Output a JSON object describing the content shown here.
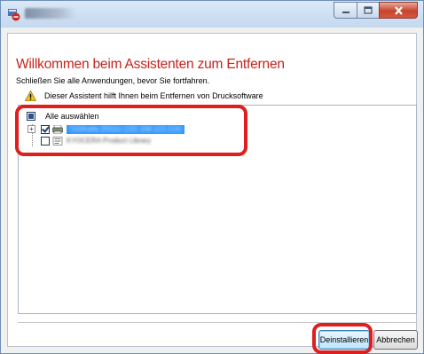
{
  "window": {
    "title": "",
    "accent_color": "#c8221a",
    "highlight_color": "#e01e1e"
  },
  "caption_buttons": {
    "minimize": "minimize-icon",
    "maximize": "maximize-icon",
    "close": "close-icon"
  },
  "main": {
    "heading": "Willkommen beim Assistenten zum Entfernen",
    "instruction": "Schließen Sie alle Anwendungen, bevor Sie fortfahren.",
    "info_icon": "warning-icon",
    "info_text": "Dieser Assistent hilft Ihnen beim Entfernen von Drucksoftware"
  },
  "list": {
    "select_all_label": "Alle auswählen",
    "items": [
      {
        "label": "TASKalfa 2552ci (192.168.123.216)",
        "checked": true,
        "selected": true,
        "expanded": false
      },
      {
        "label": "KYOCERA Product Library",
        "checked": false,
        "selected": false
      }
    ]
  },
  "buttons": {
    "uninstall": "Deinstallieren",
    "cancel": "Abbrechen"
  }
}
